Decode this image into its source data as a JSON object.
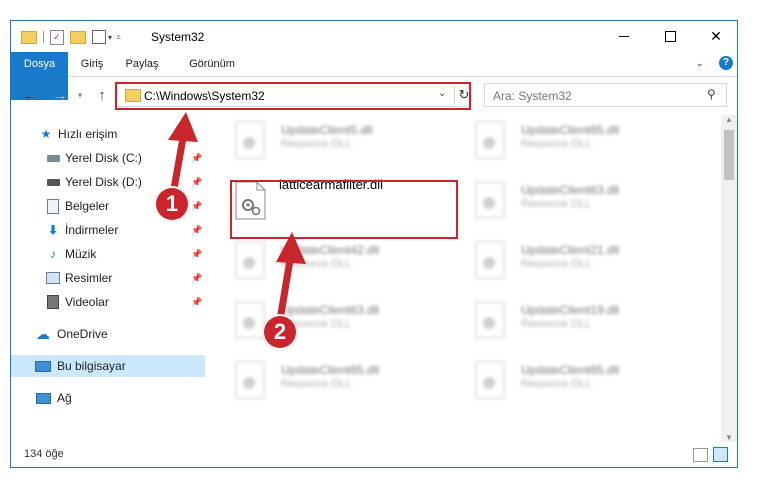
{
  "window": {
    "title": "System32"
  },
  "ribbon": {
    "tabs": [
      "Dosya",
      "Giriş",
      "Paylaş",
      "Görünüm"
    ]
  },
  "address": {
    "path": "C:\\Windows\\System32"
  },
  "search": {
    "placeholder": "Ara: System32"
  },
  "sidebar": {
    "items": [
      {
        "label": "Hızlı erişim",
        "icon": "star-icon"
      },
      {
        "label": "Yerel Disk (C:)",
        "icon": "drive-icon",
        "pinned": true
      },
      {
        "label": "Yerel Disk (D:)",
        "icon": "drive-icon",
        "pinned": true
      },
      {
        "label": "Belgeler",
        "icon": "document-icon",
        "pinned": true
      },
      {
        "label": "İndirmeler",
        "icon": "download-icon",
        "pinned": true
      },
      {
        "label": "Müzik",
        "icon": "music-icon",
        "pinned": true
      },
      {
        "label": "Resimler",
        "icon": "picture-icon",
        "pinned": true
      },
      {
        "label": "Videolar",
        "icon": "video-icon",
        "pinned": true
      },
      {
        "label": "OneDrive",
        "icon": "cloud-icon"
      },
      {
        "label": "Bu bilgisayar",
        "icon": "computer-icon",
        "selected": true
      },
      {
        "label": "Ağ",
        "icon": "network-icon"
      }
    ]
  },
  "files": {
    "highlighted": {
      "name": "latticearmafilter.dll"
    },
    "left_column": [
      {
        "name": "UpdateClient5.dll",
        "type": "Resource DLL"
      },
      {
        "name": "UpdateClient42.dll",
        "type": "Resource DLL"
      },
      {
        "name": "UpdateClient63.dll",
        "type": "Resource DLL"
      },
      {
        "name": "UpdateClient65.dll",
        "type": "Resource DLL"
      }
    ],
    "right_column": [
      {
        "name": "UpdateClient65.dll",
        "type": "Resource DLL"
      },
      {
        "name": "UpdateClient63.dll",
        "type": "Resource DLL"
      },
      {
        "name": "UpdateClient21.dll",
        "type": "Resource DLL"
      },
      {
        "name": "UpdateClient19.dll",
        "type": "Resource DLL"
      },
      {
        "name": "UpdateClient65.dll",
        "type": "Resource DLL"
      }
    ]
  },
  "status": {
    "count": "134 öğe"
  },
  "annotations": {
    "step1": "1",
    "step2": "2"
  },
  "colors": {
    "accent": "#1979ca",
    "highlight": "#c9252c",
    "selected": "#cce8ff"
  }
}
